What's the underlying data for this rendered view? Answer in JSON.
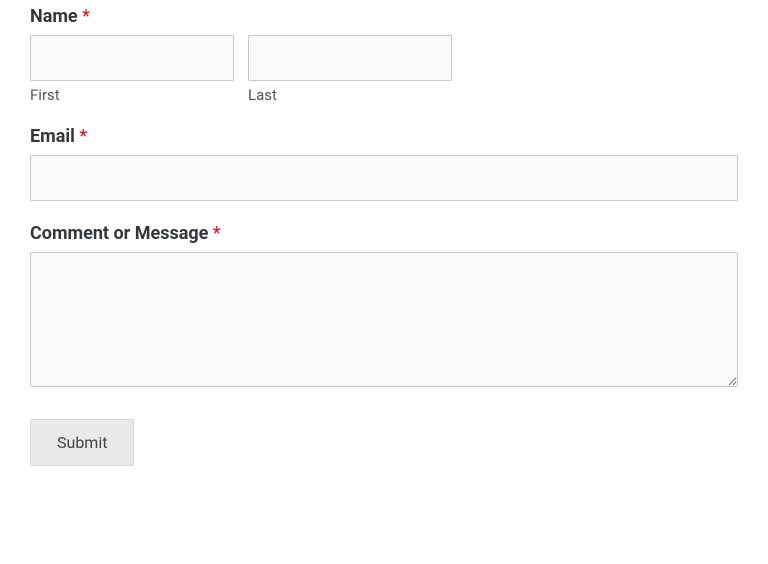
{
  "form": {
    "name": {
      "label": "Name",
      "required_mark": "*",
      "first_sublabel": "First",
      "last_sublabel": "Last",
      "first_value": "",
      "last_value": ""
    },
    "email": {
      "label": "Email",
      "required_mark": "*",
      "value": ""
    },
    "message": {
      "label": "Comment or Message",
      "required_mark": "*",
      "value": ""
    },
    "submit_label": "Submit"
  }
}
